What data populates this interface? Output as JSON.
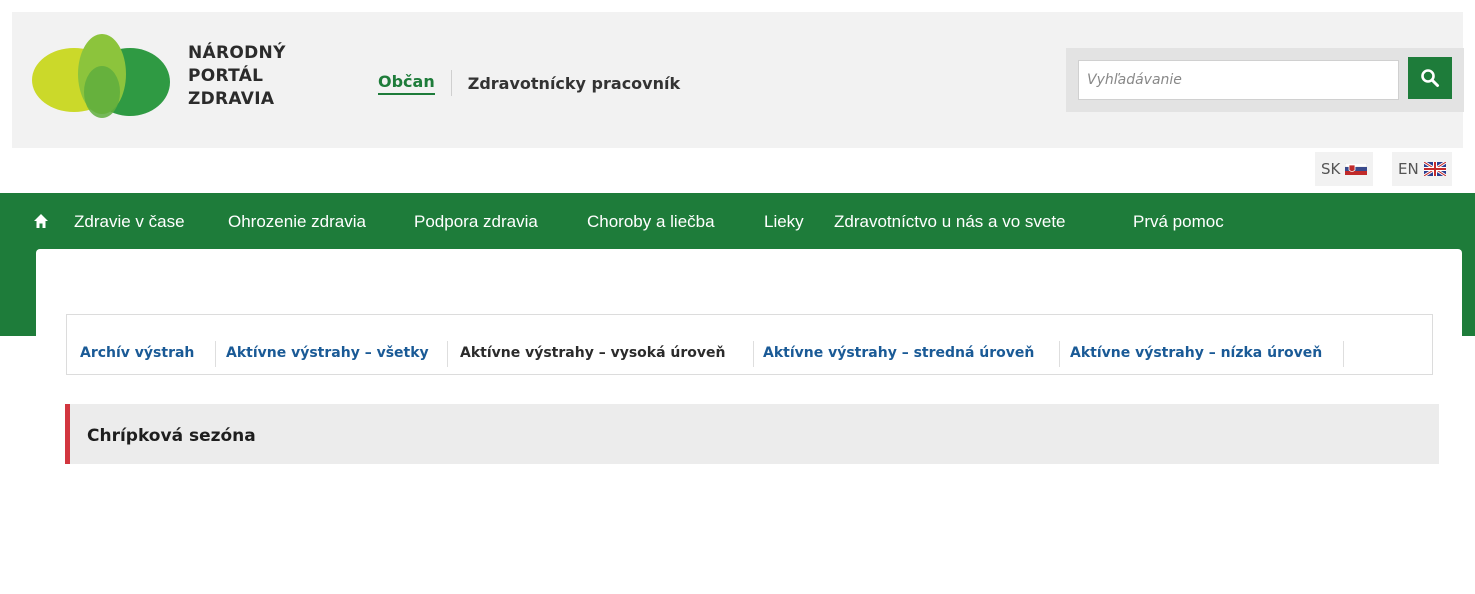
{
  "brand": {
    "line1": "NÁRODNÝ",
    "line2": "PORTÁL",
    "line3": "ZDRAVIA"
  },
  "audience_tabs": [
    {
      "label": "Občan",
      "active": true
    },
    {
      "label": "Zdravotnícky pracovník",
      "active": false
    }
  ],
  "search": {
    "placeholder": "Vyhľadávanie",
    "icon": "search-icon"
  },
  "languages": [
    {
      "code": "SK",
      "icon": "slovak-flag-icon"
    },
    {
      "code": "EN",
      "icon": "uk-flag-icon"
    }
  ],
  "main_nav": {
    "home_icon": "home-icon",
    "items": [
      "Zdravie v čase",
      "Ohrozenie zdravia",
      "Podpora zdravia",
      "Choroby a liečba",
      "Lieky",
      "Zdravotníctvo u nás a vo svete",
      "Prvá pomoc"
    ]
  },
  "sub_nav": [
    {
      "label": "Archív výstrah",
      "current": false
    },
    {
      "label": "Aktívne výstrahy – všetky",
      "current": false
    },
    {
      "label": "Aktívne výstrahy – vysoká úroveň",
      "current": true
    },
    {
      "label": "Aktívne výstrahy – stredná úroveň",
      "current": false
    },
    {
      "label": "Aktívne výstrahy – nízka úroveň",
      "current": false
    }
  ],
  "alert": {
    "title": "Chrípková sezóna",
    "level_color": "#d2363f"
  },
  "colors": {
    "primary_green": "#1e7c3a",
    "link_blue": "#1a5a96",
    "header_bg": "#f2f2f2"
  }
}
